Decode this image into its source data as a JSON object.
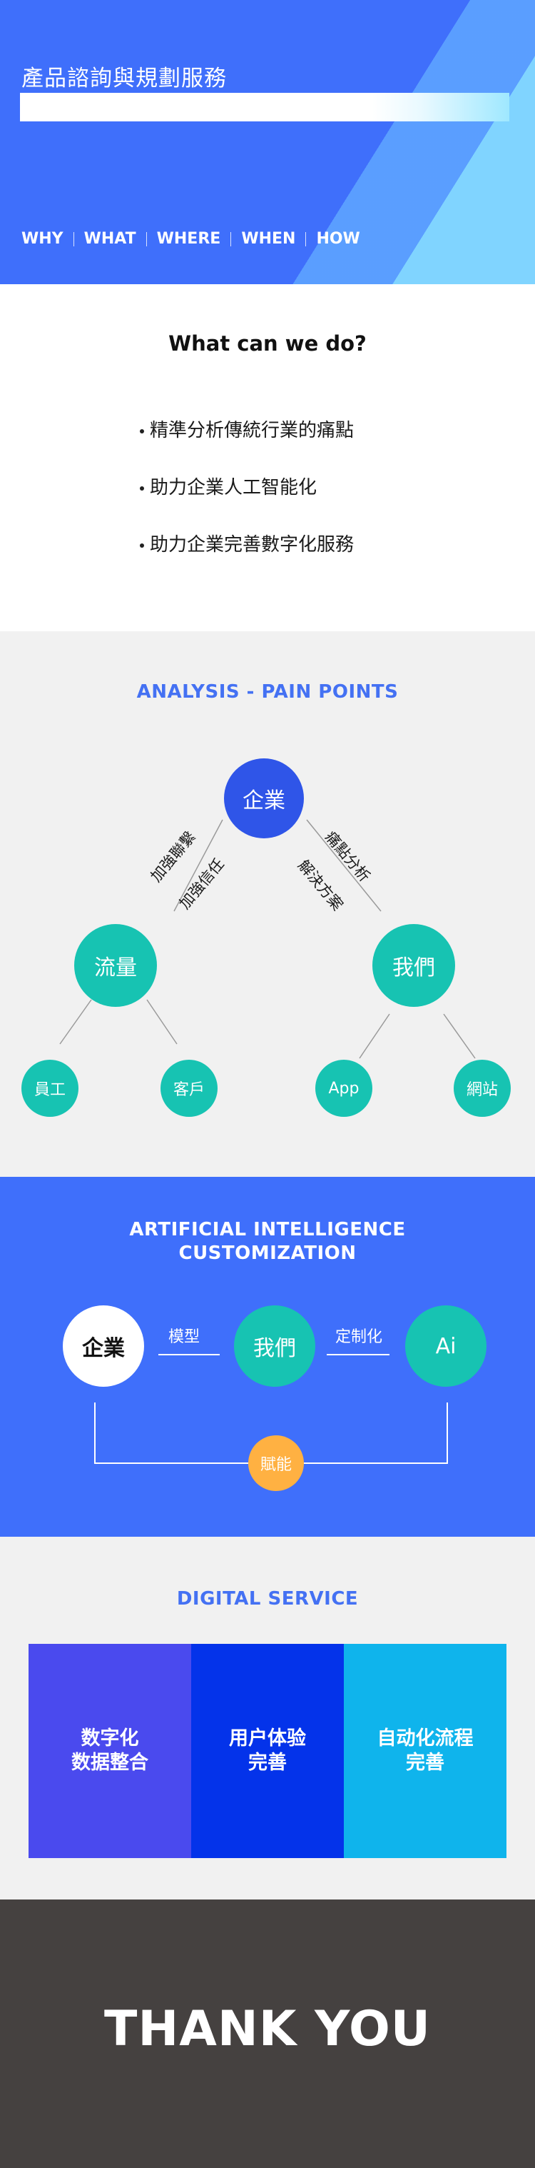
{
  "hero": {
    "title": "產品諮詢與規劃服務",
    "nav": [
      "WHY",
      "WHAT",
      "WHERE",
      "WHEN",
      "HOW"
    ]
  },
  "what": {
    "title": "What can we do?",
    "items": [
      "精準分析傳統行業的痛點",
      "助力企業人工智能化",
      "助力企業完善數字化服務"
    ]
  },
  "analysis": {
    "title": "ANALYSIS - PAIN POINTS",
    "root": "企業",
    "left": "流量",
    "right": "我們",
    "left_edge_labels": [
      "加強聯繫",
      "加強信任"
    ],
    "right_edge_labels": [
      "痛點分析",
      "解決方案"
    ],
    "left_leaves": [
      "員工",
      "客戶"
    ],
    "right_leaves": [
      "App",
      "網站"
    ]
  },
  "ai": {
    "title_line1": "ARTIFICIAL INTELLIGENCE",
    "title_line2": "CUSTOMIZATION",
    "nodes": [
      "企業",
      "我們",
      "Ai"
    ],
    "links": [
      "模型",
      "定制化"
    ],
    "bottom": "賦能"
  },
  "digital": {
    "title": "DIGITAL SERVICE",
    "blocks": [
      {
        "line1": "数字化",
        "line2": "数据整合",
        "color": "#4a4aee"
      },
      {
        "line1": "用户体验",
        "line2": "完善",
        "color": "#0433ea"
      },
      {
        "line1": "自动化流程",
        "line2": "完善",
        "color": "#0fb4ec"
      }
    ]
  },
  "thanks": {
    "text": "THANK YOU"
  },
  "colors": {
    "primary": "#3f6ffb",
    "teal": "#17c3b2",
    "orange": "#ffb142",
    "dark": "#454140"
  }
}
